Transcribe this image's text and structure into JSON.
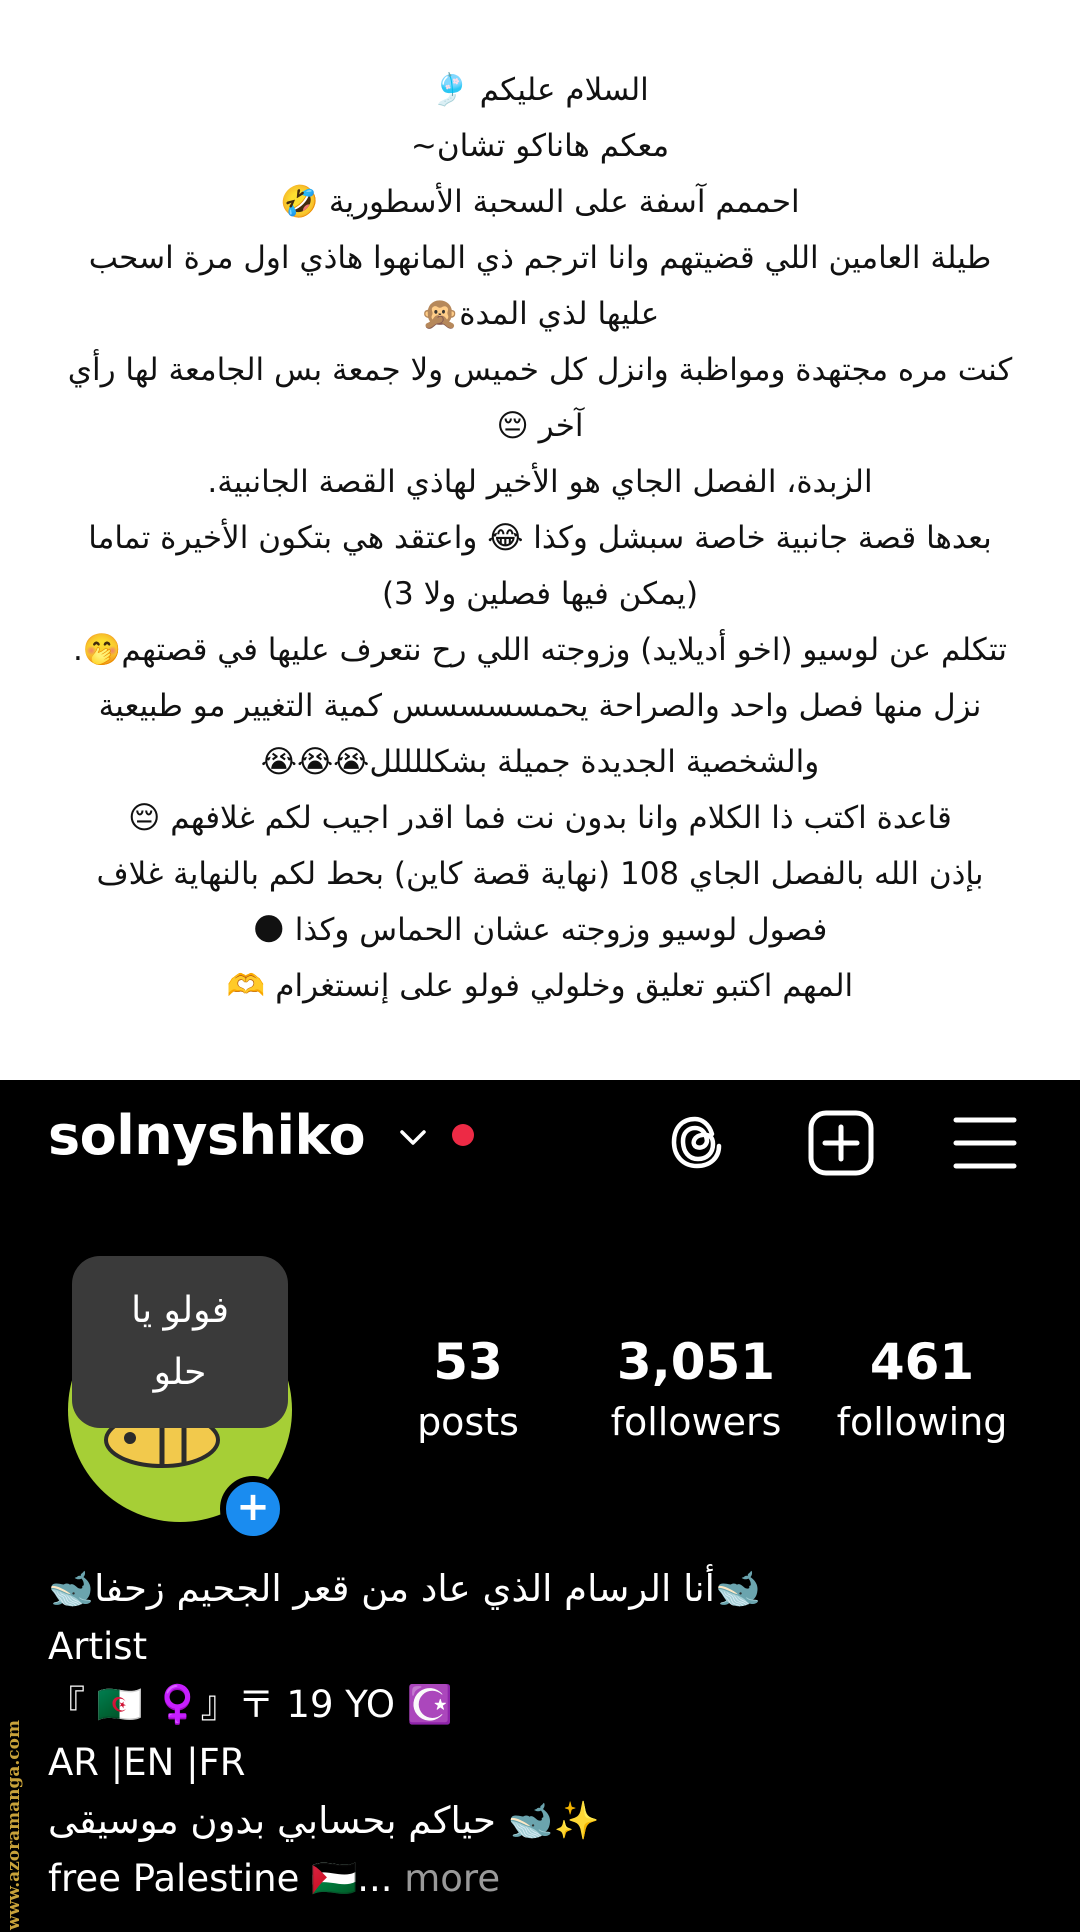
{
  "note": {
    "lines": [
      "السلام عليكم 🎐",
      "معكم هاناكو تشان~",
      "احممم آسفة على السحبة الأسطورية 🤣",
      "طيلة العامين اللي قضيتهم وانا اترجم ذي المانهوا هاذي اول مرة اسحب",
      "عليها لذي المدة🙊",
      "كنت مره مجتهدة ومواظبة وانزل كل خميس ولا جمعة بس الجامعة لها رأي",
      "آخر 😔",
      "الزبدة، الفصل الجاي هو الأخير لهاذي القصة الجانبية.",
      "بعدها قصة جانبية خاصة سبشل وكذا 😂 واعتقد هي بتكون الأخيرة تماما",
      "(يمكن فيها فصلين ولا 3)",
      "تتكلم عن لوسيو (اخو أديلايد) وزوجته اللي رح نتعرف عليها في قصتهم🤭.",
      "نزل منها فصل واحد والصراحة يحمسسسسس كمية التغيير مو طبيعية",
      "والشخصية الجديدة جميلة بشكللللل😭😭😭",
      "قاعدة اكتب ذا الكلام وانا بدون نت فما اقدر اجيب لكم غلافهم 😔",
      "بإذن الله بالفصل الجاي 108 (نهاية قصة كاين) بحط لكم بالنهاية غلاف",
      "فصول لوسيو وزوجته عشان الحماس وكذا 🌑",
      "المهم اكتبو تعليق وخلولي فولو على إنستغرام 🫶"
    ]
  },
  "profile": {
    "username": "solnyshiko",
    "icons": {
      "dropdown": "chevron-down-icon",
      "notification": "red-dot-icon",
      "threads": "threads-icon",
      "create": "plus-square-icon",
      "menu": "hamburger-menu-icon",
      "add_story": "plus-icon"
    },
    "note_bubble": {
      "line1": "فولو يا",
      "line2": "حلو"
    },
    "stats": {
      "posts": {
        "value": "53",
        "label": "posts"
      },
      "followers": {
        "value": "3,051",
        "label": "followers"
      },
      "following": {
        "value": "461",
        "label": "following"
      }
    },
    "bio": {
      "name_line": "🐋أنا الرسام الذي عاد من قعر الجحيم زحفا🐋",
      "category": "Artist",
      "line3": "『 🇩🇿 ♀️』〒 19 YO ☪️",
      "line4": "AR |EN |FR",
      "line5": "✨🐋 حياكم بحسابي بدون موسيقى",
      "line6_text": "free Palestine 🇵🇸...",
      "more": " more"
    }
  },
  "watermark": "www.azoramanga.com",
  "colors": {
    "profile_bg": "#000000",
    "note_bg": "#ffffff",
    "notification_dot": "#ed2a45",
    "add_badge": "#1a8cf0",
    "avatar_bg": "#a6cf36",
    "bubble_bg": "#3a3a3a",
    "more_text": "#9a9a9a"
  }
}
